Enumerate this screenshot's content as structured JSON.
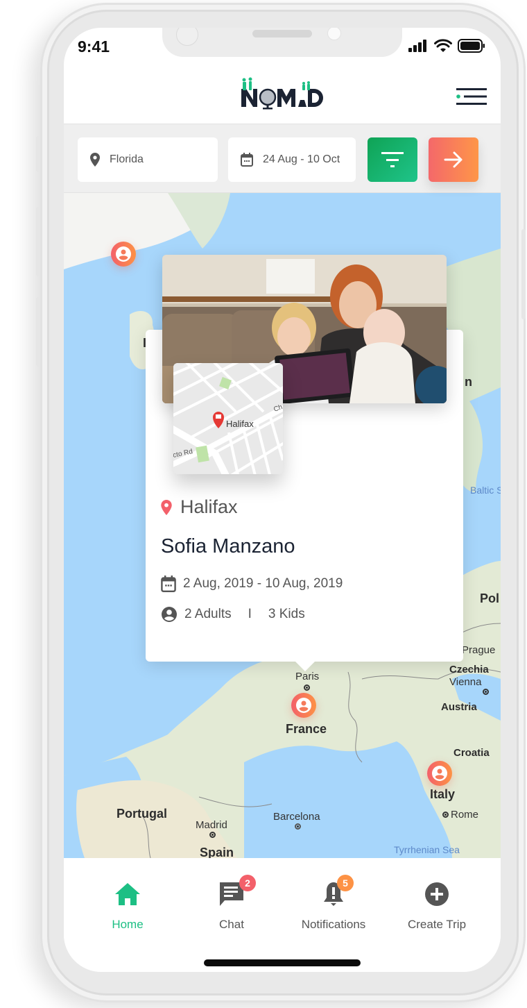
{
  "status_bar": {
    "time": "9:41"
  },
  "header": {
    "logo_text": "NOMAD"
  },
  "search": {
    "location_value": "Florida",
    "date_value": "24 Aug - 10 Oct"
  },
  "map": {
    "labels": {
      "paris": "Paris",
      "france": "France",
      "prague": "Prague",
      "czechia": "Czechia",
      "vienna": "Vienna",
      "austria": "Austria",
      "croatia": "Croatia",
      "italy": "Italy",
      "rome": "Rome",
      "tyrrhenian": "Tyrrhenian Sea",
      "portugal": "Portugal",
      "madrid": "Madrid",
      "spain": "Spain",
      "barcelona": "Barcelona",
      "baltic": "Baltic S",
      "poland": "Pol",
      "sweden_fragment": "n",
      "ireland_fragment": "I"
    }
  },
  "card": {
    "mini_map_label": "Halifax",
    "mini_map_road1": "cto Rd",
    "mini_map_road2": "Ch",
    "location": "Halifax",
    "name": "Sofia Manzano",
    "dates": "2 Aug, 2019 - 10 Aug, 2019",
    "adults": "2 Adults",
    "separator": "I",
    "kids": "3 Kids"
  },
  "tabs": [
    {
      "label": "Home",
      "active": true
    },
    {
      "label": "Chat",
      "badge": "2"
    },
    {
      "label": "Notifications",
      "badge": "5"
    },
    {
      "label": "Create Trip"
    }
  ],
  "colors": {
    "accent_green": "#1dbf84",
    "accent_orange": "#fd9245",
    "accent_red": "#f3606a",
    "text_dark": "#1b2333"
  }
}
